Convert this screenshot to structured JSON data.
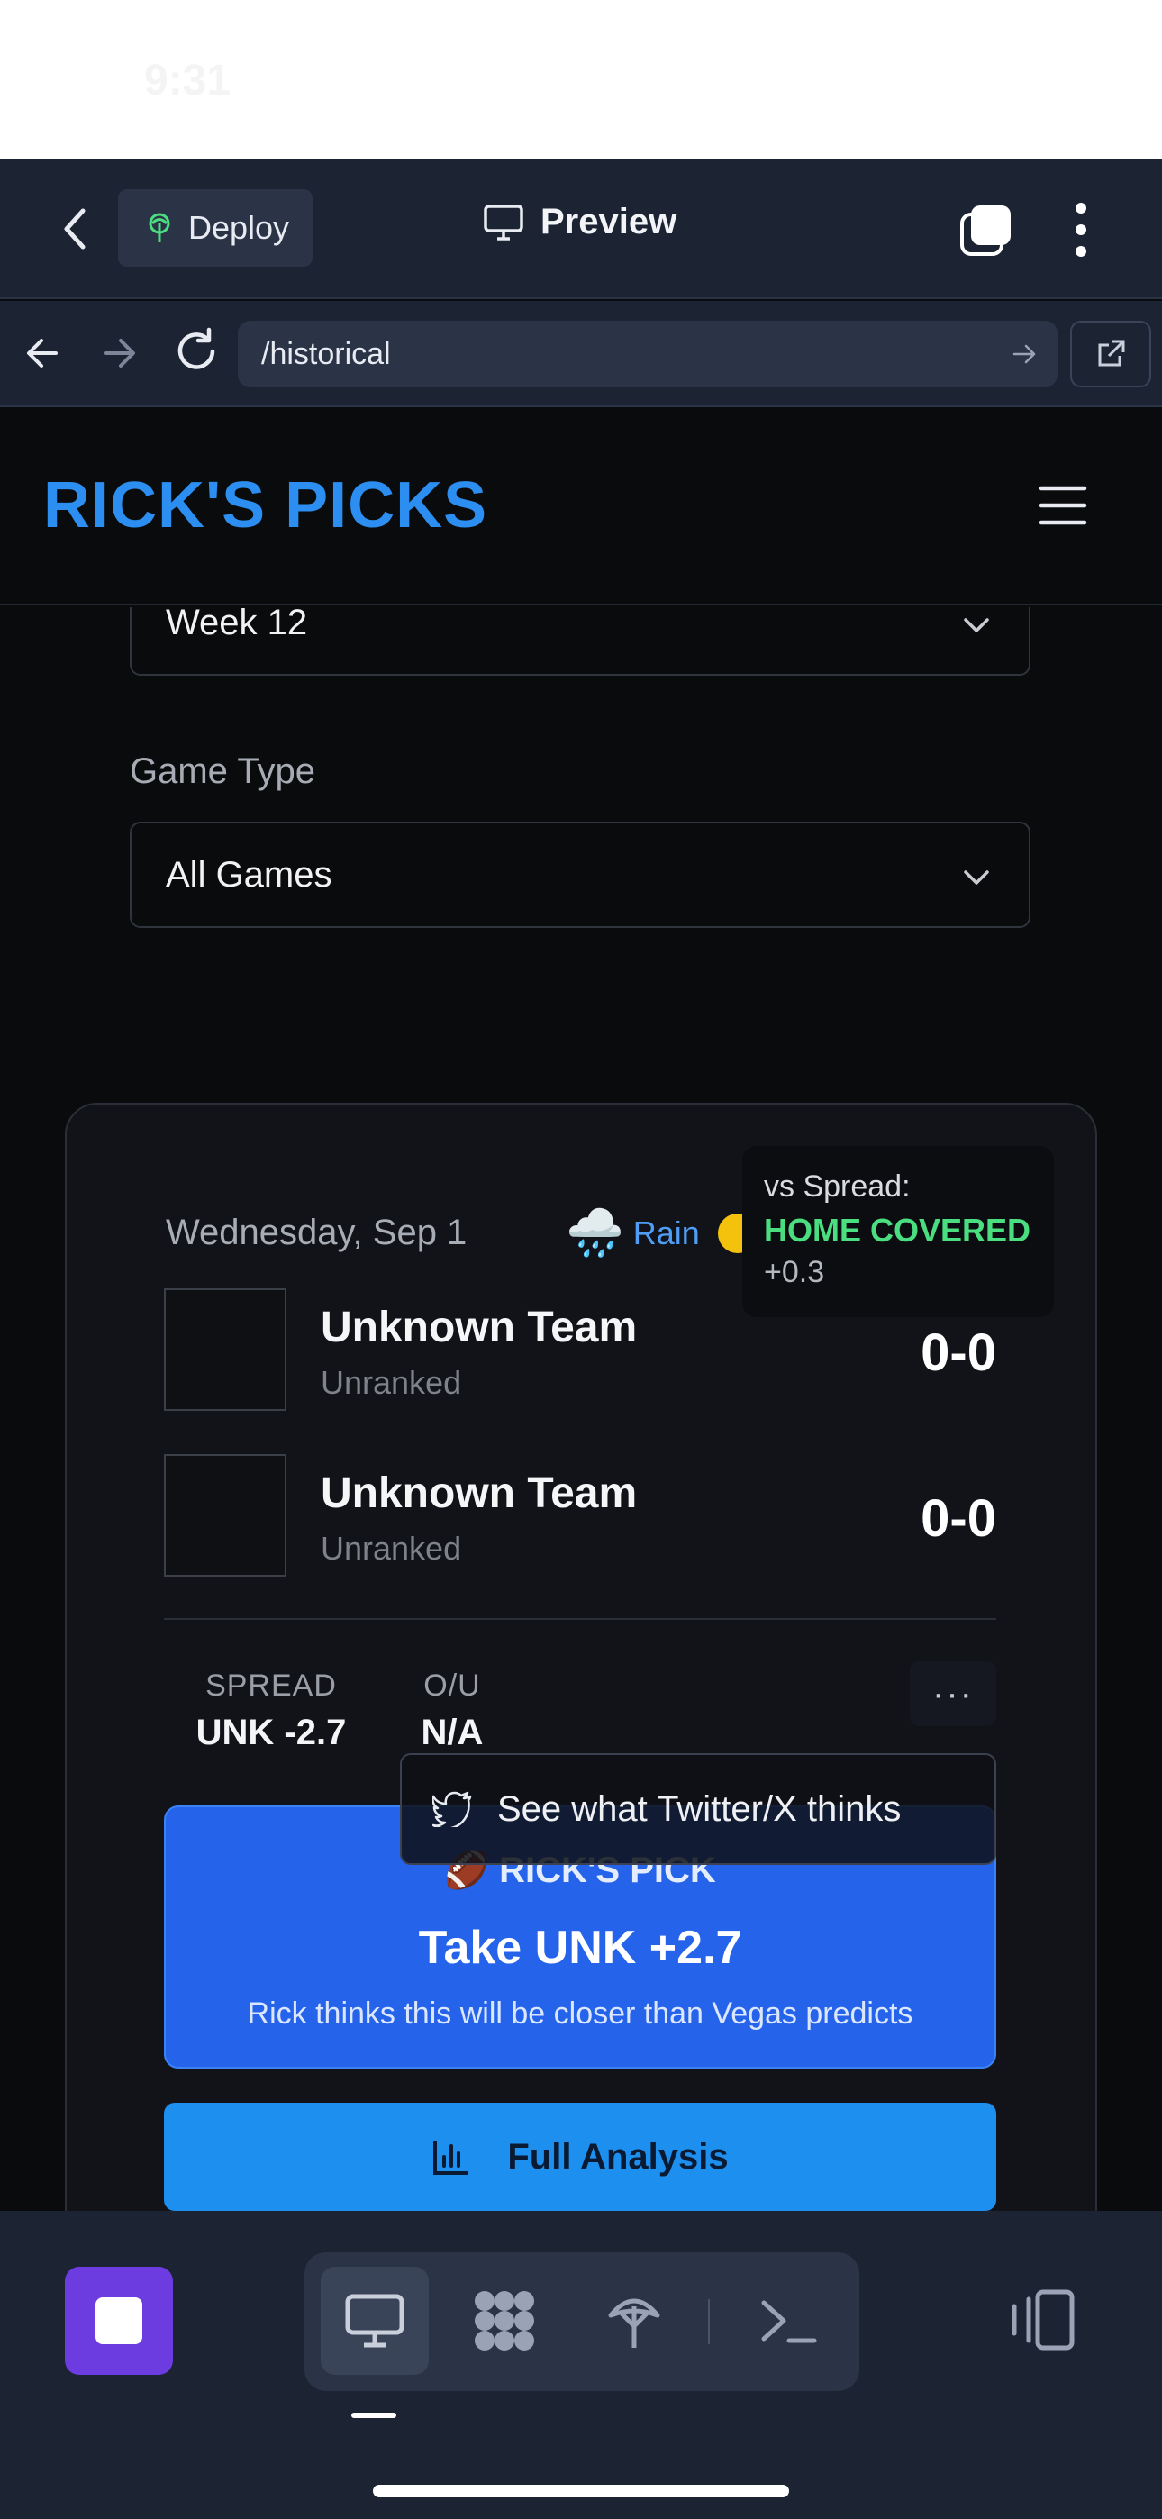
{
  "status_bar": {
    "time": "9:31"
  },
  "ide": {
    "deploy_label": "Deploy",
    "preview_label": "Preview",
    "url": "/historical"
  },
  "app": {
    "brand": "RICK'S PICKS"
  },
  "filters": {
    "week_value": "Week 12",
    "game_type_label": "Game Type",
    "game_type_value": "All Games"
  },
  "game": {
    "date": "Wednesday, Sep 1",
    "weather_emoji": "🌧️",
    "weather_label": "Rain",
    "tooltip": {
      "line1": "vs Spread:",
      "line2": "HOME COVERED",
      "line3": "+0.3"
    },
    "teams": [
      {
        "name": "Unknown Team",
        "rank": "Unranked",
        "record": "0-0"
      },
      {
        "name": "Unknown Team",
        "rank": "Unranked",
        "record": "0-0"
      }
    ],
    "spread_label": "SPREAD",
    "spread_value": "UNK -2.7",
    "ou_label": "O/U",
    "ou_value": "N/A",
    "more_label": "···",
    "twitter_label": "See what Twitter/X thinks",
    "pick": {
      "title": "🏈 RICK'S PICK",
      "main": "Take UNK +2.7",
      "sub": "Rick thinks this will be closer than Vegas predicts"
    },
    "analysis_label": "Full Analysis"
  },
  "colors": {
    "accent": "#2b8ef0",
    "pick_panel": "#2563eb",
    "covered": "#4ade80",
    "ide_bg": "#1c2333",
    "stop": "#6d3ce0"
  }
}
